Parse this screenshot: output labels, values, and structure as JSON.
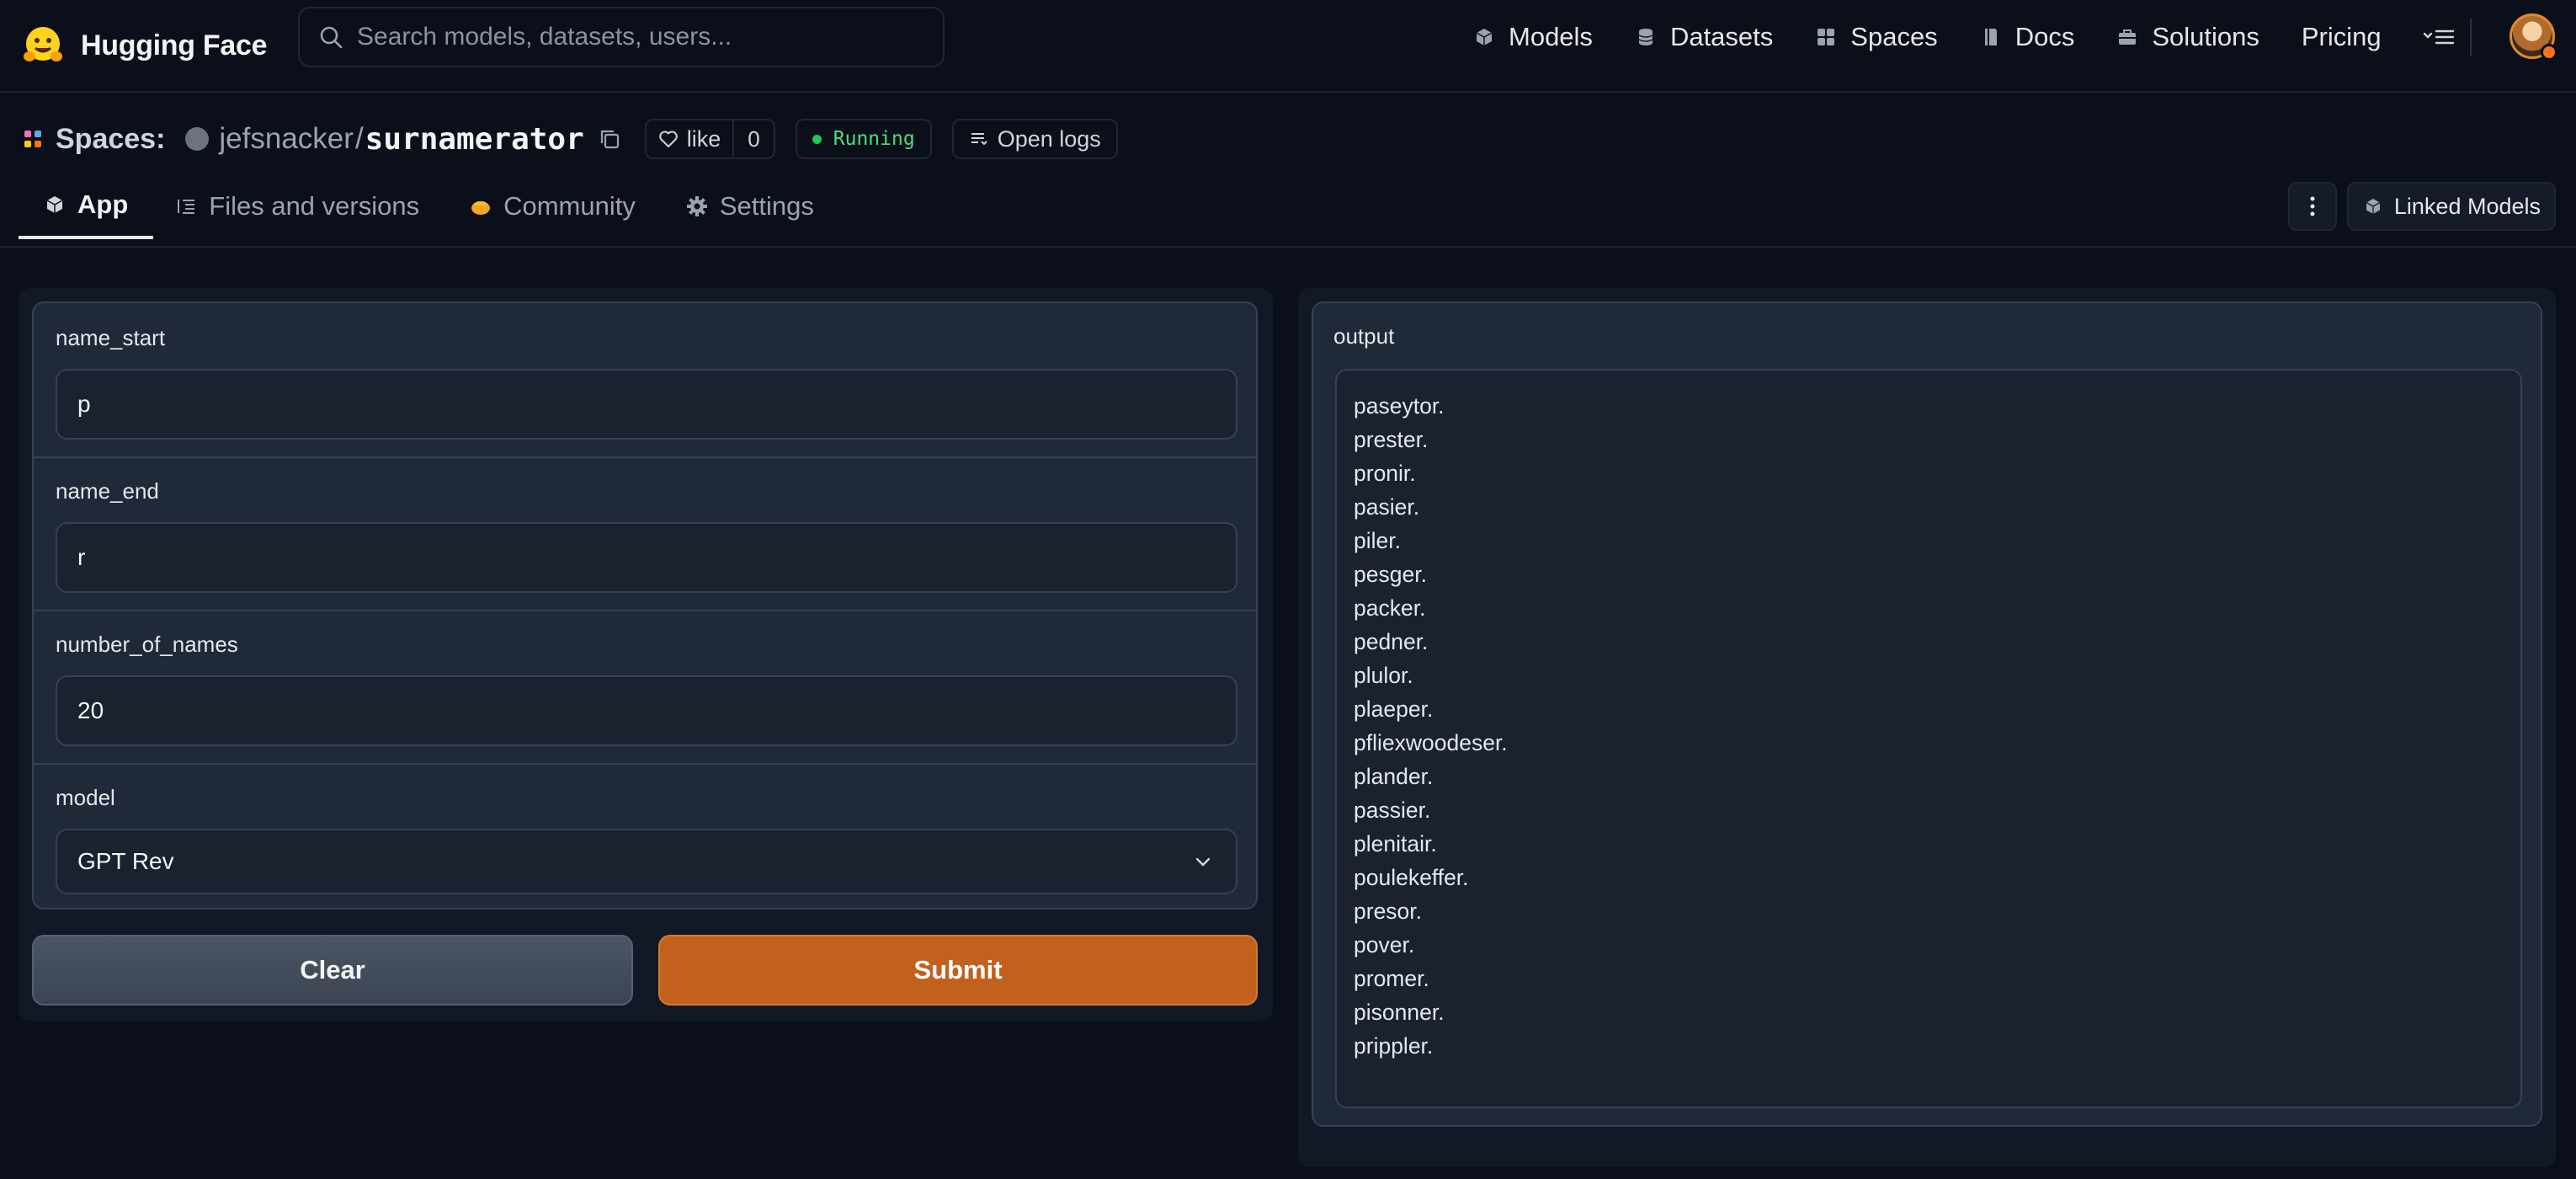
{
  "brand": {
    "name": "Hugging Face",
    "logo_icon": "hugging-face-logo"
  },
  "search": {
    "placeholder": "Search models, datasets, users..."
  },
  "nav": {
    "models": "Models",
    "datasets": "Datasets",
    "spaces": "Spaces",
    "docs": "Docs",
    "solutions": "Solutions",
    "pricing": "Pricing"
  },
  "space": {
    "section_label": "Spaces:",
    "owner": "jefsnacker",
    "separator": "/",
    "name": "surnamerator",
    "like_label": "like",
    "like_count": "0",
    "status": "Running",
    "open_logs": "Open logs"
  },
  "tabs": {
    "app": "App",
    "files": "Files and versions",
    "community": "Community",
    "settings": "Settings"
  },
  "actions": {
    "linked_models": "Linked Models"
  },
  "form": {
    "name_start": {
      "label": "name_start",
      "value": "p"
    },
    "name_end": {
      "label": "name_end",
      "value": "r"
    },
    "number_of_names": {
      "label": "number_of_names",
      "value": "20"
    },
    "model": {
      "label": "model",
      "value": "GPT Rev"
    },
    "clear_label": "Clear",
    "submit_label": "Submit"
  },
  "output": {
    "label": "output",
    "lines": [
      "paseytor.",
      "prester.",
      "pronir.",
      "pasier.",
      "piler.",
      "pesger.",
      "packer.",
      "pedner.",
      "plulor.",
      "plaeper.",
      "pfliexwoodeser.",
      "plander.",
      "passier.",
      "plenitair.",
      "poulekeffer.",
      "presor.",
      "pover.",
      "promer.",
      "pisonner.",
      "prippler."
    ]
  },
  "colors": {
    "background": "#0b0f19",
    "panel": "#1f2937",
    "submit": "#c2611e",
    "status_running": "#22c55e"
  }
}
